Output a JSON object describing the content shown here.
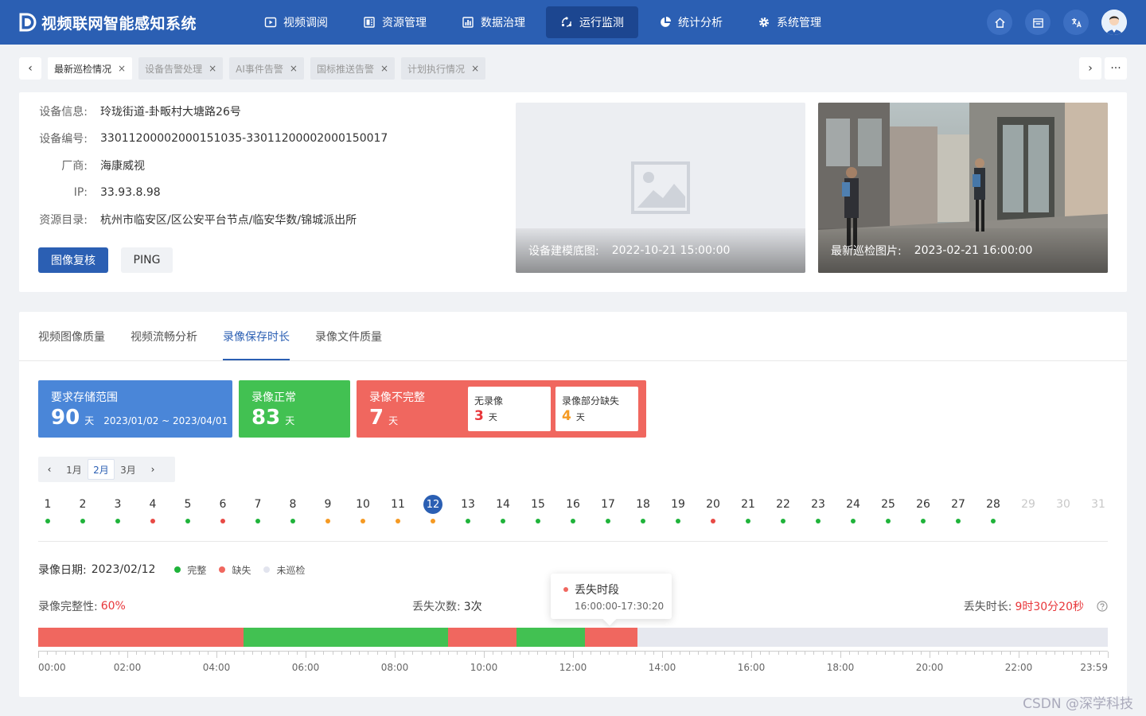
{
  "app": {
    "title": "视频联网智能感知系统"
  },
  "nav": [
    {
      "label": "视频调阅",
      "icon": "play-icon",
      "active": false
    },
    {
      "label": "资源管理",
      "icon": "folder-icon",
      "active": false
    },
    {
      "label": "数据治理",
      "icon": "bar-chart-icon",
      "active": false
    },
    {
      "label": "运行监测",
      "icon": "monitor-cycle-icon",
      "active": true
    },
    {
      "label": "统计分析",
      "icon": "pie-chart-icon",
      "active": false
    },
    {
      "label": "系统管理",
      "icon": "gear-icon",
      "active": false
    }
  ],
  "header_icons": [
    "home-icon",
    "calendar-icon",
    "translate-icon"
  ],
  "tabs": [
    {
      "label": "最新巡检情况",
      "active": true
    },
    {
      "label": "设备告警处理",
      "active": false
    },
    {
      "label": "AI事件告警",
      "active": false
    },
    {
      "label": "国标推送告警",
      "active": false
    },
    {
      "label": "计划执行情况",
      "active": false
    }
  ],
  "device": {
    "rows": [
      {
        "label": "设备信息:",
        "value": "玲珑街道-卦畈村大塘路26号"
      },
      {
        "label": "设备编号:",
        "value": "33011200002000151035-33011200002000150017"
      },
      {
        "label": "厂商:",
        "value": "海康威视"
      },
      {
        "label": "IP:",
        "value": "33.93.8.98"
      },
      {
        "label": "资源目录:",
        "value": "杭州市临安区/区公安平台节点/临安华数/锦城派出所"
      }
    ],
    "btn_review": "图像复核",
    "btn_ping": "PING",
    "model_img": {
      "label": "设备建模底图:",
      "time": "2022-10-21 15:00:00"
    },
    "latest_img": {
      "label": "最新巡检图片:",
      "time": "2023-02-21 16:00:00"
    }
  },
  "subtabs": [
    {
      "label": "视频图像质量",
      "active": false
    },
    {
      "label": "视频流畅分析",
      "active": false
    },
    {
      "label": "录像保存时长",
      "active": true
    },
    {
      "label": "录像文件质量",
      "active": false
    }
  ],
  "stats": {
    "required": {
      "title": "要求存储范围",
      "value": "90",
      "unit": "天",
      "range": "2023/01/02 ~ 2023/04/01",
      "color": "#4a86d8"
    },
    "normal": {
      "title": "录像正常",
      "value": "83",
      "unit": "天",
      "color": "#42c152"
    },
    "incomplete": {
      "title": "录像不完整",
      "value": "7",
      "unit": "天",
      "color": "#f0675f",
      "none": {
        "title": "无录像",
        "value": "3",
        "unit": "天",
        "color": "#e8363a"
      },
      "partial": {
        "title": "录像部分缺失",
        "value": "4",
        "unit": "天",
        "color": "#f59a23"
      }
    }
  },
  "months": [
    {
      "label": "1月",
      "active": false
    },
    {
      "label": "2月",
      "active": true
    },
    {
      "label": "3月",
      "active": false
    }
  ],
  "days": {
    "labels": [
      "1",
      "2",
      "3",
      "4",
      "5",
      "6",
      "7",
      "8",
      "9",
      "10",
      "11",
      "12",
      "13",
      "14",
      "15",
      "16",
      "17",
      "18",
      "19",
      "20",
      "21",
      "22",
      "23",
      "24",
      "25",
      "26",
      "27",
      "28",
      "29",
      "30",
      "31"
    ],
    "status": [
      "ok",
      "ok",
      "ok",
      "none",
      "ok",
      "none",
      "ok",
      "ok",
      "partial",
      "partial",
      "partial",
      "partial",
      "ok",
      "ok",
      "ok",
      "ok",
      "ok",
      "ok",
      "ok",
      "none",
      "ok",
      "ok",
      "ok",
      "ok",
      "ok",
      "ok",
      "ok",
      "ok",
      "na",
      "na",
      "na"
    ],
    "selected": 12
  },
  "status_colors": {
    "ok": "#1fb33a",
    "none": "#e84a45",
    "partial": "#f59a23"
  },
  "record": {
    "date_label": "录像日期:",
    "date": "2023/02/12",
    "legend": [
      {
        "label": "完整",
        "color": "#1fb33a"
      },
      {
        "label": "缺失",
        "color": "#f0675f"
      },
      {
        "label": "未巡检",
        "color": "#e2e4ee"
      }
    ],
    "integrity_label": "录像完整性:",
    "integrity_value": "60%",
    "lost_count_label": "丢失次数:",
    "lost_count_value": "3次",
    "lost_duration_label": "丢失时长:",
    "lost_duration_value": "9时30分20秒",
    "tooltip_title": "丢失时段",
    "tooltip_time": "16:00:00-17:30:20"
  },
  "timeline": {
    "segments": [
      {
        "state": "missing",
        "start_h": 0,
        "end_h": 4.6
      },
      {
        "state": "complete",
        "start_h": 4.6,
        "end_h": 9.2
      },
      {
        "state": "missing",
        "start_h": 9.2,
        "end_h": 10.73
      },
      {
        "state": "complete",
        "start_h": 10.73,
        "end_h": 12.27
      },
      {
        "state": "missing",
        "start_h": 12.27,
        "end_h": 13.45
      }
    ],
    "colors": {
      "missing": "#f0675f",
      "complete": "#42c152"
    },
    "tick_labels": [
      "00:00",
      "02:00",
      "04:00",
      "06:00",
      "08:00",
      "10:00",
      "12:00",
      "14:00",
      "16:00",
      "18:00",
      "20:00",
      "22:00",
      "23:59"
    ]
  },
  "watermark": "CSDN @深学科技"
}
